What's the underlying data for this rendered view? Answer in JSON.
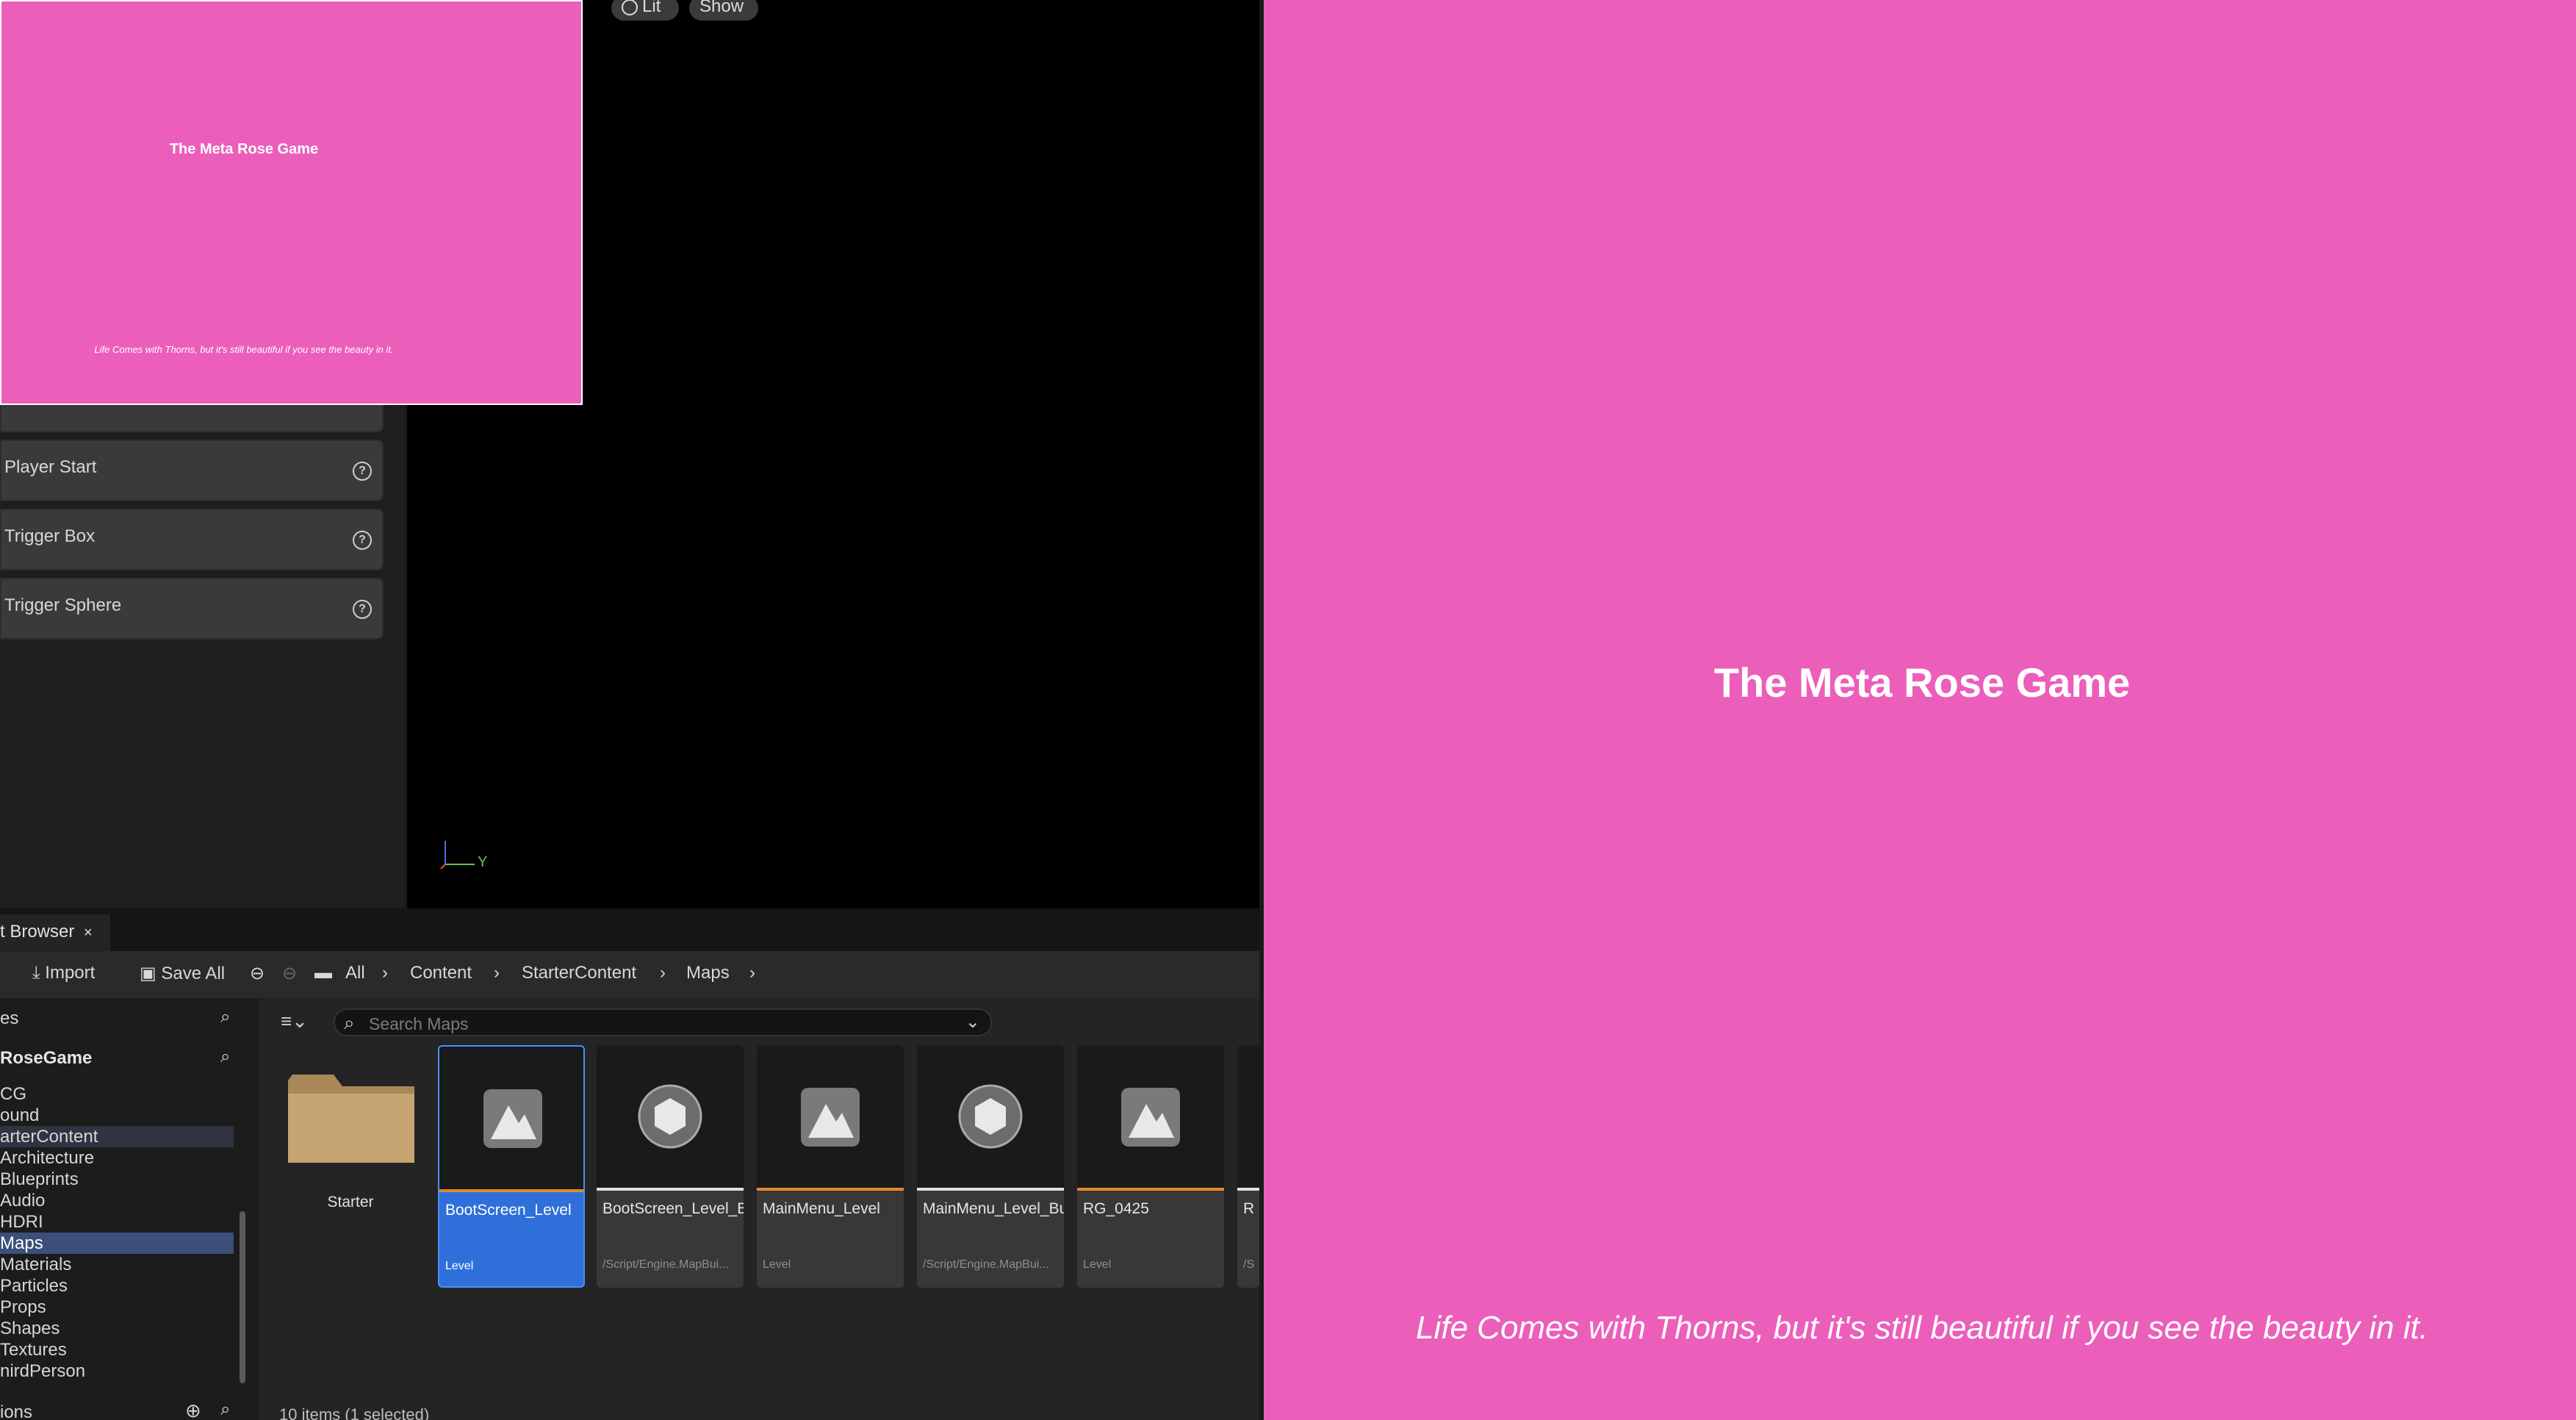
{
  "viewport": {
    "lit_label": "Lit",
    "show_label": "Show",
    "axis_label": "Y"
  },
  "preview_small": {
    "title": "The Meta Rose Game",
    "tagline": "Life Comes with Thorns, but it's still beautiful if you see the beauty in it."
  },
  "place_actors": {
    "items": [
      {
        "label": "Player Start"
      },
      {
        "label": "Trigger Box"
      },
      {
        "label": "Trigger Sphere"
      }
    ]
  },
  "content_browser": {
    "tab_label": "t Browser",
    "toolbar": {
      "import_label": "Import",
      "save_all_label": "Save All"
    },
    "breadcrumb": [
      "All",
      "Content",
      "StarterContent",
      "Maps"
    ],
    "sources_header": "es",
    "project_header": "RoseGame",
    "tree": [
      "CG",
      "ound",
      "arterContent",
      "Architecture",
      "Blueprints",
      "Audio",
      "HDRI",
      "Maps",
      "Materials",
      "Particles",
      "Props",
      "Shapes",
      "Textures",
      "nirdPerson"
    ],
    "tree_selected": "Maps",
    "collections_header": "ions",
    "search_placeholder": "Search Maps",
    "status": "10 items (1 selected)",
    "tiles": [
      {
        "name": "Starter",
        "type": ""
      },
      {
        "name": "BootScreen_Level",
        "type": "Level"
      },
      {
        "name": "BootScreen_Level_BuiltData",
        "type": "/Script/Engine.MapBui..."
      },
      {
        "name": "MainMenu_Level",
        "type": "Level"
      },
      {
        "name": "MainMenu_Level_BuiltData",
        "type": "/Script/Engine.MapBui..."
      },
      {
        "name": "RG_0425",
        "type": "Level"
      },
      {
        "name": "R",
        "type": "/S"
      }
    ]
  },
  "game_preview": {
    "title": "The Meta Rose Game",
    "tagline": "Life Comes with Thorns, but it's still beautiful if you see the beauty in it."
  },
  "colors": {
    "pink": "#eb5fbb",
    "selection": "#2f6fd9",
    "level_bar": "#e08a2a"
  }
}
